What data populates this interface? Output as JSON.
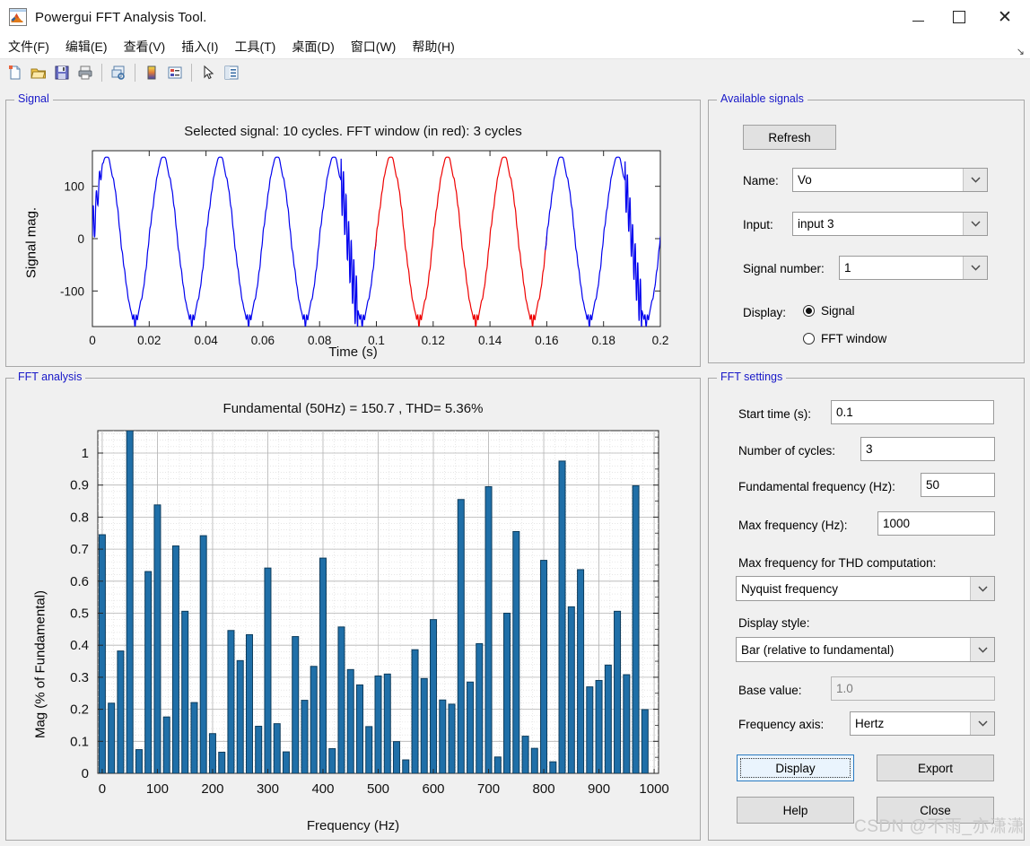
{
  "window": {
    "title": "Powergui FFT Analysis Tool.",
    "icon": "matlab-logo-icon",
    "minimize": "—",
    "maximize": "□",
    "close": "✕"
  },
  "menu": {
    "items": [
      {
        "label": "文件(F)",
        "accel": "F"
      },
      {
        "label": "编辑(E)",
        "accel": "E"
      },
      {
        "label": "查看(V)",
        "accel": "V"
      },
      {
        "label": "插入(I)",
        "accel": "I"
      },
      {
        "label": "工具(T)",
        "accel": "T"
      },
      {
        "label": "桌面(D)",
        "accel": "D"
      },
      {
        "label": "窗口(W)",
        "accel": "W"
      },
      {
        "label": "帮助(H)",
        "accel": "H"
      }
    ],
    "corner": "↘"
  },
  "toolbar": {
    "buttons": [
      "new-figure-icon",
      "open-file-icon",
      "save-icon",
      "print-icon",
      "link-plot-icon",
      "colorbar-icon",
      "legend-icon",
      "pointer-icon",
      "property-inspector-icon"
    ]
  },
  "panels": {
    "signal": "Signal",
    "fft_analysis": "FFT analysis",
    "available_signals": "Available signals",
    "fft_settings": "FFT settings"
  },
  "available_signals": {
    "refresh_label": "Refresh",
    "name_label": "Name:",
    "name_value": "Vo",
    "input_label": "Input:",
    "input_value": "input 3",
    "signal_number_label": "Signal number:",
    "signal_number_value": "1",
    "display_label": "Display:",
    "radio_signal": "Signal",
    "radio_fft_window": "FFT window",
    "selected": "Signal"
  },
  "fft_settings": {
    "start_time_label": "Start time (s):",
    "start_time_value": "0.1",
    "num_cycles_label": "Number of cycles:",
    "num_cycles_value": "3",
    "fundamental_freq_label": "Fundamental frequency (Hz):",
    "fundamental_freq_value": "50",
    "max_freq_label": "Max frequency (Hz):",
    "max_freq_value": "1000",
    "max_freq_thd_label": "Max frequency for THD computation:",
    "max_freq_thd_value": "Nyquist frequency",
    "display_style_label": "Display style:",
    "display_style_value": "Bar (relative to fundamental)",
    "base_value_label": "Base value:",
    "base_value_value": "1.0",
    "freq_axis_label": "Frequency axis:",
    "freq_axis_value": "Hertz",
    "display_button": "Display",
    "export_button": "Export",
    "help_button": "Help",
    "close_button": "Close"
  },
  "watermark": "CSDN @不雨_亦潇潇",
  "chart_data": [
    {
      "id": "signal-plot",
      "type": "line",
      "title": "Selected signal: 10 cycles. FFT window (in red): 3 cycles",
      "xlabel": "Time (s)",
      "ylabel": "Signal mag.",
      "xlim": [
        0,
        0.2
      ],
      "ylim": [
        -168,
        168
      ],
      "xticks": [
        0,
        0.02,
        0.04,
        0.06,
        0.08,
        0.1,
        0.12,
        0.14,
        0.16,
        0.18,
        0.2
      ],
      "xticklabels": [
        "0",
        "0.02",
        "0.04",
        "0.06",
        "0.08",
        "0.1",
        "0.12",
        "0.14",
        "0.16",
        "0.18",
        "0.2"
      ],
      "yticks": [
        -100,
        0,
        100
      ],
      "yticklabels": [
        "-100",
        "0",
        "100"
      ],
      "grid": false,
      "cycles_total": 10,
      "fundamental_hz": 50,
      "amplitude": 155,
      "series": [
        {
          "name": "signal",
          "color": "#0000ee",
          "x_range": [
            0,
            0.1
          ],
          "note": "blue portion, cycles 1-5"
        },
        {
          "name": "fft-window",
          "color": "#ee0000",
          "x_range": [
            0.1,
            0.16
          ],
          "note": "red highlighted FFT window, 3 cycles"
        },
        {
          "name": "signal-tail",
          "color": "#0000ee",
          "x_range": [
            0.16,
            0.2
          ],
          "note": "blue portion, cycles 9-10"
        }
      ]
    },
    {
      "id": "fft-bar-chart",
      "type": "bar",
      "title": "Fundamental (50Hz) = 150.7 , THD= 5.36%",
      "xlabel": "Frequency (Hz)",
      "ylabel": "Mag (% of Fundamental)",
      "xlim": [
        -8,
        1008
      ],
      "ylim": [
        0,
        1.07
      ],
      "xticks": [
        0,
        100,
        200,
        300,
        400,
        500,
        600,
        700,
        800,
        900,
        1000
      ],
      "xticklabels": [
        "0",
        "100",
        "200",
        "300",
        "400",
        "500",
        "600",
        "700",
        "800",
        "900",
        "1000"
      ],
      "yticks": [
        0,
        0.1,
        0.2,
        0.3,
        0.4,
        0.5,
        0.6,
        0.7,
        0.8,
        0.9,
        1
      ],
      "yticklabels": [
        "0",
        "0.1",
        "0.2",
        "0.3",
        "0.4",
        "0.5",
        "0.6",
        "0.7",
        "0.8",
        "0.9",
        "1"
      ],
      "grid": true,
      "bar_color": "#1f6fa8",
      "bar_edge": "#0d3c5c",
      "bar_step_hz": 16.667,
      "fundamental_value": 150.7,
      "thd_percent": 5.36,
      "x": [
        0,
        16.7,
        33.3,
        50,
        66.7,
        83.3,
        100,
        116.7,
        133.3,
        150,
        166.7,
        183.3,
        200,
        216.7,
        233.3,
        250,
        266.7,
        283.3,
        300,
        316.7,
        333.3,
        350,
        366.7,
        383.3,
        400,
        416.7,
        433.3,
        450,
        466.7,
        483.3,
        500,
        516.7,
        533.3,
        550,
        566.7,
        583.3,
        600,
        616.7,
        633.3,
        650,
        666.7,
        683.3,
        700,
        716.7,
        733.3,
        750,
        766.7,
        783.3,
        800,
        816.7,
        833.3,
        850,
        866.7,
        883.3,
        900,
        916.7,
        933.3,
        950,
        966.7,
        983.3,
        1000
      ],
      "values": [
        0.745,
        0.219,
        0.382,
        1.07,
        0.074,
        0.63,
        0.838,
        0.176,
        0.71,
        0.506,
        0.221,
        0.742,
        0.124,
        0.066,
        0.446,
        0.352,
        0.433,
        0.147,
        0.641,
        0.155,
        0.067,
        0.427,
        0.228,
        0.334,
        0.672,
        0.077,
        0.457,
        0.324,
        0.276,
        0.146,
        0.304,
        0.31,
        0.099,
        0.042,
        0.386,
        0.296,
        0.48,
        0.229,
        0.216,
        0.855,
        0.285,
        0.405,
        0.895,
        0.051,
        0.5,
        0.755,
        0.116,
        0.078,
        0.665,
        0.036,
        0.975,
        0.52,
        0.636,
        0.27,
        0.29,
        0.338,
        0.506,
        0.308,
        0.898,
        0.199,
        0.0
      ]
    }
  ]
}
